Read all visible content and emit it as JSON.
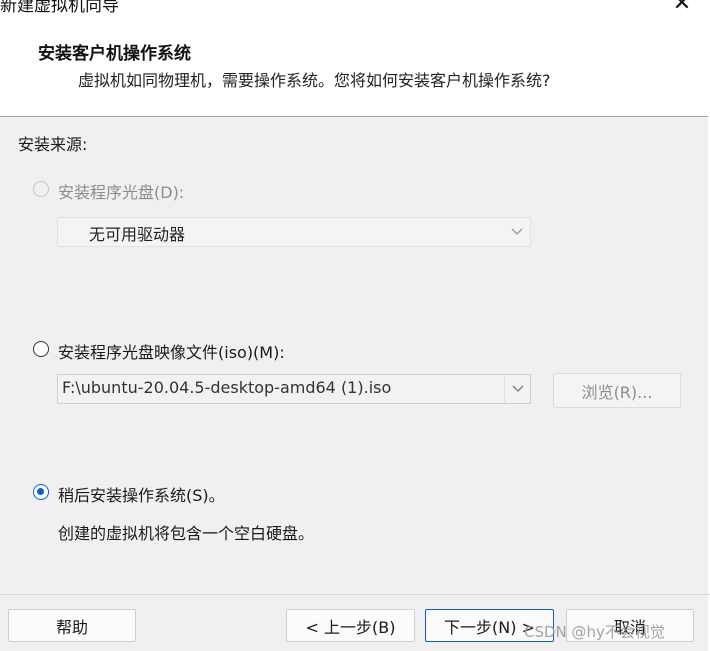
{
  "window": {
    "title": "新建虚拟机向导",
    "close_symbol": "✕"
  },
  "header": {
    "title": "安装客户机操作系统",
    "subtitle": "虚拟机如同物理机，需要操作系统。您将如何安装客户机操作系统?"
  },
  "source_label": "安装来源:",
  "options": {
    "disc": {
      "label": "安装程序光盘(D):",
      "selected": false,
      "enabled": false,
      "drive_value": "无可用驱动器"
    },
    "iso": {
      "label": "安装程序光盘映像文件(iso)(M):",
      "selected": false,
      "enabled": true,
      "path_value": "F:\\ubuntu-20.04.5-desktop-amd64 (1).iso",
      "browse_label": "浏览(R)..."
    },
    "later": {
      "label": "稍后安装操作系统(S)。",
      "selected": true,
      "enabled": true,
      "description": "创建的虚拟机将包含一个空白硬盘。"
    }
  },
  "footer": {
    "help_label": "帮助",
    "back_label": "< 上一步(B)",
    "next_label": "下一步(N) >",
    "cancel_label": "取消"
  },
  "watermark": "CSDN @hy不会视觉",
  "colors": {
    "accent": "#0a5fd6",
    "disabled_text": "#8c8c8c",
    "background": "#f0f0f0"
  }
}
